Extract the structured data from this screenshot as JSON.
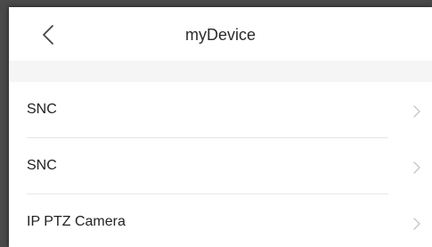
{
  "header": {
    "title": "myDevice",
    "back_icon": "chevron-left-icon"
  },
  "devices": [
    {
      "label": "SNC",
      "icon": "chevron-right-icon"
    },
    {
      "label": "SNC",
      "icon": "chevron-right-icon"
    },
    {
      "label": "IP PTZ Camera",
      "icon": "chevron-right-icon"
    }
  ],
  "colors": {
    "background": "#ffffff",
    "section_gap": "#f5f5f5",
    "divider": "#e6e6e6",
    "chevron": "#c4c4c4",
    "text": "#222222"
  }
}
